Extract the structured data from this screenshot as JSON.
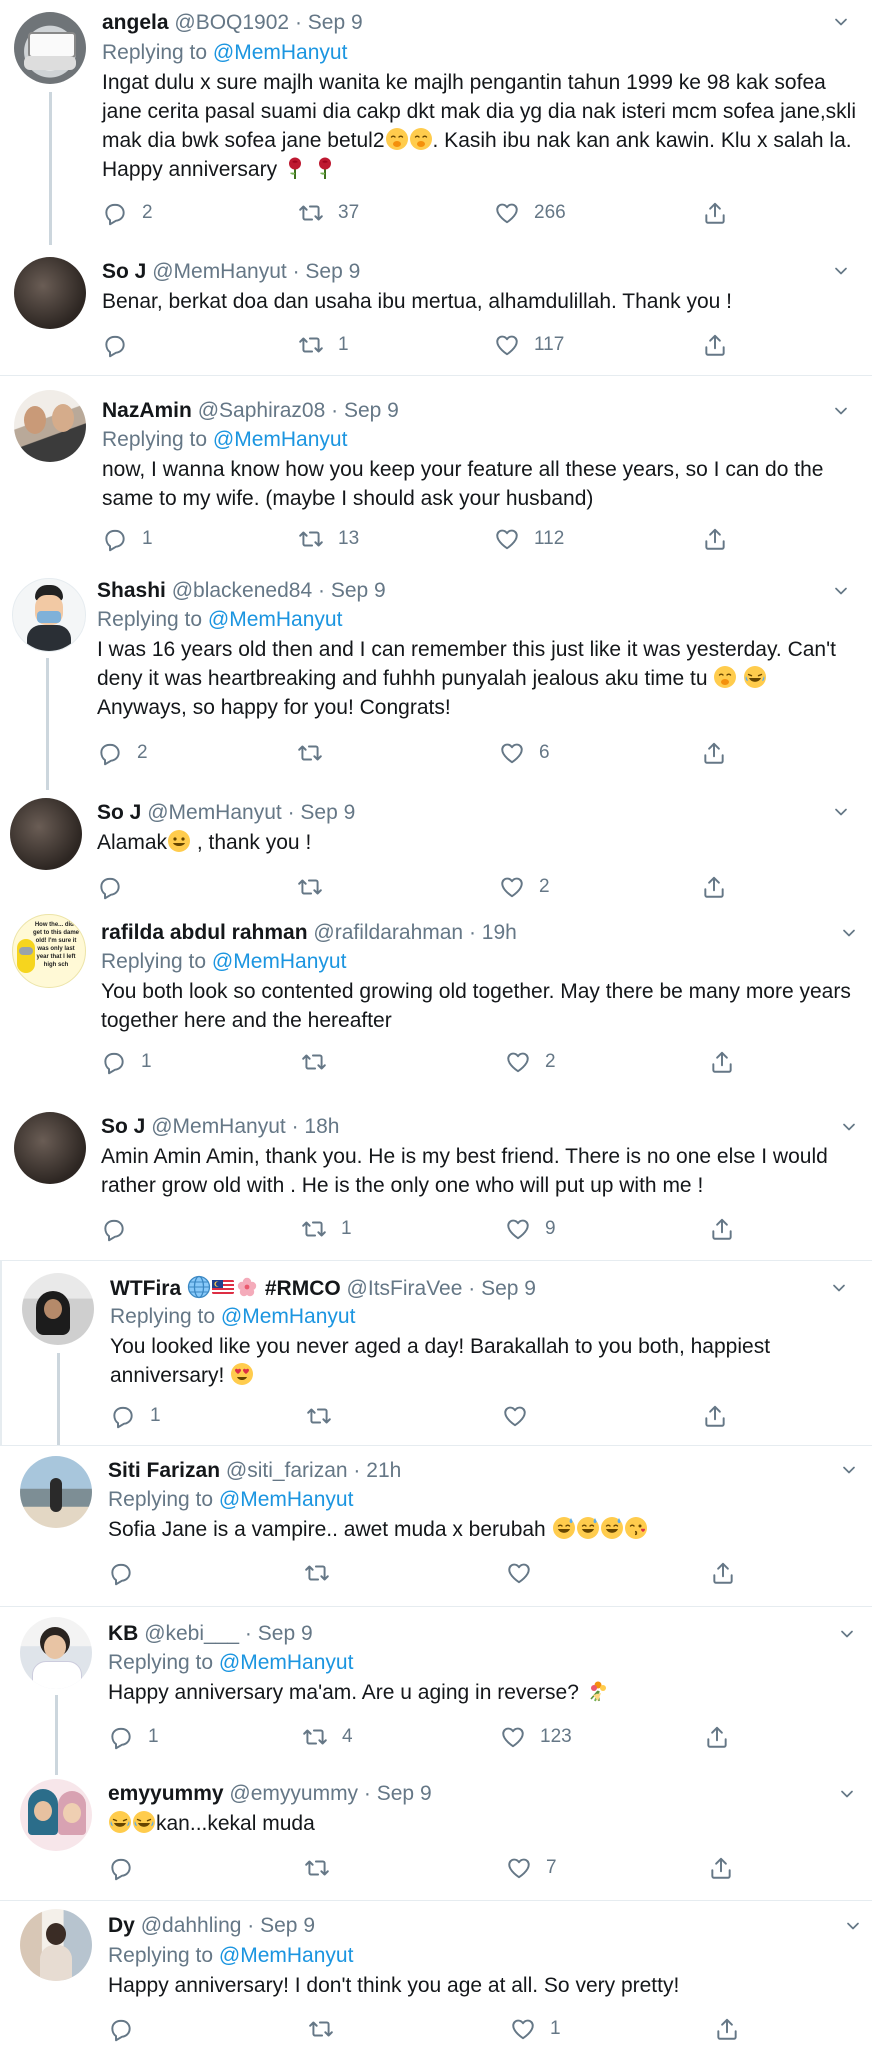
{
  "reply_prefix": "Replying to",
  "dot": "·",
  "tweets": [
    {
      "name": "angela",
      "handle": "@BOQ1902",
      "date": "Sep 9",
      "reply_to": "@MemHanyut",
      "text": "Ingat dulu x sure majlh wanita ke majlh pengantin tahun 1999 ke 98 kak sofea jane cerita pasal suami dia cakp dkt mak dia yg dia nak isteri mcm sofea jane,skli mak dia bwk sofea jane betul2",
      "text2": ". Kasih ibu nak kan ank kawin. Klu x salah la. Happy anniversary",
      "replies": "2",
      "retweets": "37",
      "likes": "266"
    },
    {
      "name": "So J",
      "handle": "@MemHanyut",
      "date": "Sep 9",
      "text": "Benar, berkat doa dan usaha ibu mertua, alhamdulillah. Thank you !",
      "replies": "",
      "retweets": "1",
      "likes": "117"
    },
    {
      "name": "NazAmin",
      "handle": "@Saphiraz08",
      "date": "Sep 9",
      "reply_to": "@MemHanyut",
      "text": "now, I wanna know how you keep your feature all these years, so I can do the same to my wife. (maybe I should ask your husband)",
      "replies": "1",
      "retweets": "13",
      "likes": "112"
    },
    {
      "name": "Shashi",
      "handle": "@blackened84",
      "date": "Sep 9",
      "reply_to": "@MemHanyut",
      "text": "I was 16 years old then and I can remember this just like it was yesterday. Can't deny it was heartbreaking and fuhhh punyalah jealous aku time tu",
      "text2": "Anyways, so happy for you! Congrats!",
      "replies": "2",
      "retweets": "",
      "likes": "6"
    },
    {
      "name": "So J",
      "handle": "@MemHanyut",
      "date": "Sep 9",
      "text": "Alamak",
      "text2": ", thank you !",
      "replies": "",
      "retweets": "",
      "likes": "2"
    },
    {
      "name": "rafilda abdul rahman",
      "handle": "@rafildarahman",
      "date": "19h",
      "reply_to": "@MemHanyut",
      "text": "You both look so contented growing old together. May there be many more years together here and the hereafter",
      "replies": "1",
      "retweets": "",
      "likes": "2",
      "avatar_text": "How the... did I get to this dame old! I'm sure it was only last year that I left high sch"
    },
    {
      "name": "So J",
      "handle": "@MemHanyut",
      "date": "18h",
      "text": "Amin Amin Amin, thank you. He is my best friend. There is no one else I would rather grow old with . He is the only one who will put up with me !",
      "replies": "",
      "retweets": "1",
      "likes": "9"
    },
    {
      "name": "WTFira",
      "name_tag": "#RMCO",
      "handle": "@ItsFiraVee",
      "date": "Sep 9",
      "reply_to": "@MemHanyut",
      "text": "You looked like you never aged a day! Barakallah to you both, happiest anniversary!",
      "replies": "1",
      "retweets": "",
      "likes": ""
    },
    {
      "name": "Siti Farizan",
      "handle": "@siti_farizan",
      "date": "21h",
      "reply_to": "@MemHanyut",
      "text": "Sofia Jane is a vampire..  awet muda x berubah",
      "replies": "",
      "retweets": "",
      "likes": ""
    },
    {
      "name": "KB",
      "handle": "@kebi___",
      "date": "Sep 9",
      "reply_to": "@MemHanyut",
      "text": "Happy anniversary ma'am. Are u aging in reverse?",
      "replies": "1",
      "retweets": "4",
      "likes": "123"
    },
    {
      "name": "emyyummy",
      "handle": "@emyyummy",
      "date": "Sep 9",
      "text": "kan...kekal muda",
      "replies": "",
      "retweets": "",
      "likes": "7"
    },
    {
      "name": "Dy",
      "handle": "@dahhling",
      "date": "Sep 9",
      "reply_to": "@MemHanyut",
      "text": "Happy anniversary! I don't think you age at all. So very pretty!",
      "replies": "",
      "retweets": "",
      "likes": "1"
    }
  ],
  "colors": {
    "text": "#14171a",
    "muted": "#657786",
    "link": "#1b95e0",
    "thread": "#ccd6dd",
    "separator": "#e6ecf0"
  },
  "icons": [
    "reply-icon",
    "retweet-icon",
    "like-icon",
    "share-icon",
    "caret-down-icon"
  ]
}
